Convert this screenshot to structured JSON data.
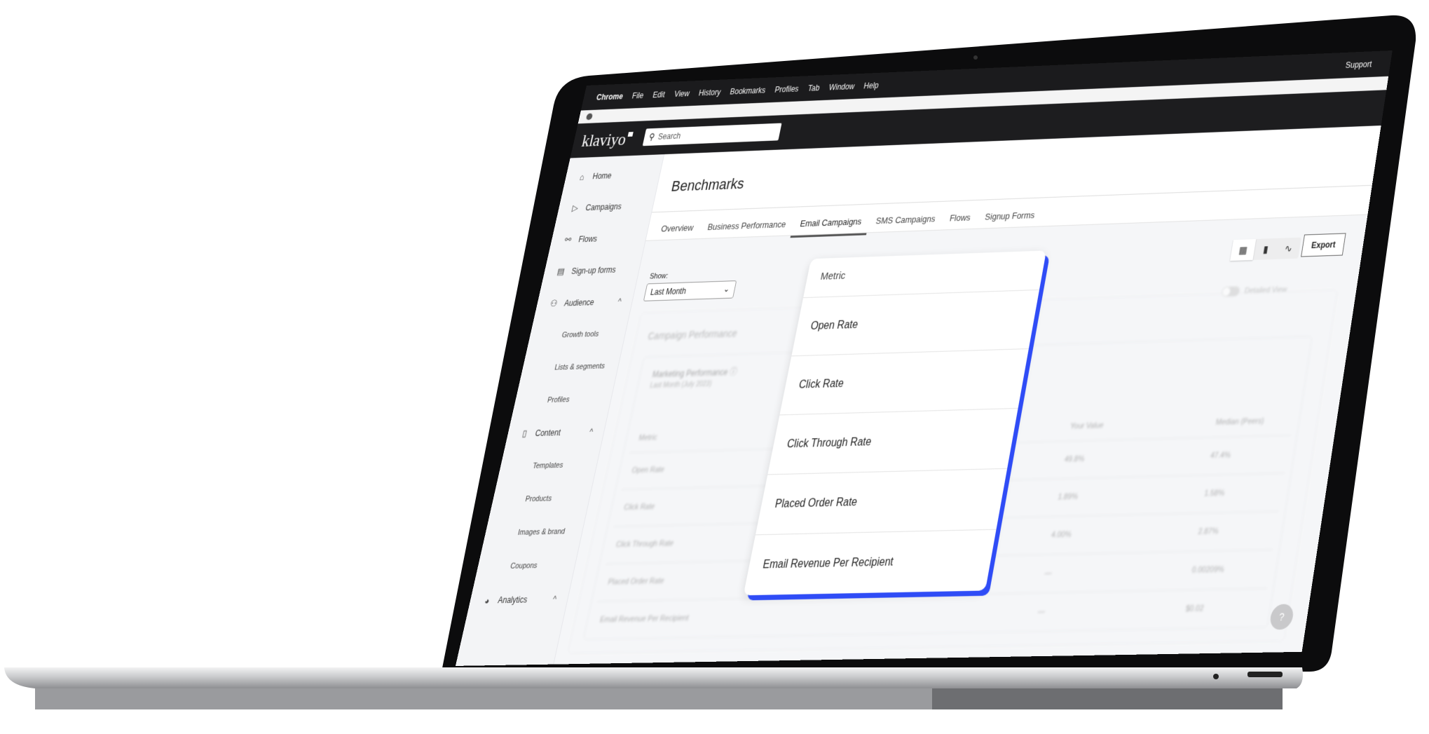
{
  "browser": {
    "app": "Chrome",
    "menu": [
      "File",
      "Edit",
      "View",
      "History",
      "Bookmarks",
      "Profiles",
      "Tab",
      "Window",
      "Help"
    ],
    "support": "Support"
  },
  "header": {
    "logo": "klaviyo",
    "search_placeholder": "Search",
    "search_icon": "search-icon"
  },
  "sidebar": {
    "items": [
      {
        "label": "Home",
        "icon": "home-icon"
      },
      {
        "label": "Campaigns",
        "icon": "send-icon"
      },
      {
        "label": "Flows",
        "icon": "flow-icon"
      },
      {
        "label": "Sign-up forms",
        "icon": "form-icon"
      },
      {
        "label": "Audience",
        "icon": "people-icon",
        "expanded": true
      },
      {
        "label": "Growth tools"
      },
      {
        "label": "Lists & segments"
      },
      {
        "label": "Profiles"
      },
      {
        "label": "Content",
        "icon": "document-icon",
        "expanded": true
      },
      {
        "label": "Templates"
      },
      {
        "label": "Products"
      },
      {
        "label": "Images & brand"
      },
      {
        "label": "Coupons"
      },
      {
        "label": "Analytics",
        "icon": "pie-chart-icon",
        "expanded": true
      }
    ]
  },
  "main": {
    "title": "Benchmarks",
    "tabs": [
      {
        "label": "Overview"
      },
      {
        "label": "Business Performance"
      },
      {
        "label": "Email Campaigns",
        "active": true
      },
      {
        "label": "SMS Campaigns"
      },
      {
        "label": "Flows"
      },
      {
        "label": "Signup Forms"
      }
    ],
    "show_label": "Show:",
    "show_value": "Last Month",
    "export": "Export",
    "detailed_view": "Detailed View",
    "card_title": "Campaign Performance",
    "section_title": "Marketing Performance ⓘ",
    "section_sub": "Last Month (July 2023)",
    "table": {
      "headers": [
        "Metric",
        "Your Value",
        "Median (Peers)"
      ],
      "rows": [
        [
          "Open Rate",
          "49.8%",
          "47.4%"
        ],
        [
          "Click Rate",
          "1.89%",
          "1.58%"
        ],
        [
          "Click Through Rate",
          "4.00%",
          "2.87%"
        ],
        [
          "Placed Order Rate",
          "—",
          "0.00209%"
        ],
        [
          "Email Revenue Per Recipient",
          "—",
          "$0.02"
        ]
      ]
    }
  },
  "popup": {
    "header": "Metric",
    "options": [
      "Open Rate",
      "Click Rate",
      "Click Through Rate",
      "Placed Order Rate",
      "Email Revenue Per Recipient"
    ],
    "accent": "#2f4cf6"
  },
  "help": "?"
}
